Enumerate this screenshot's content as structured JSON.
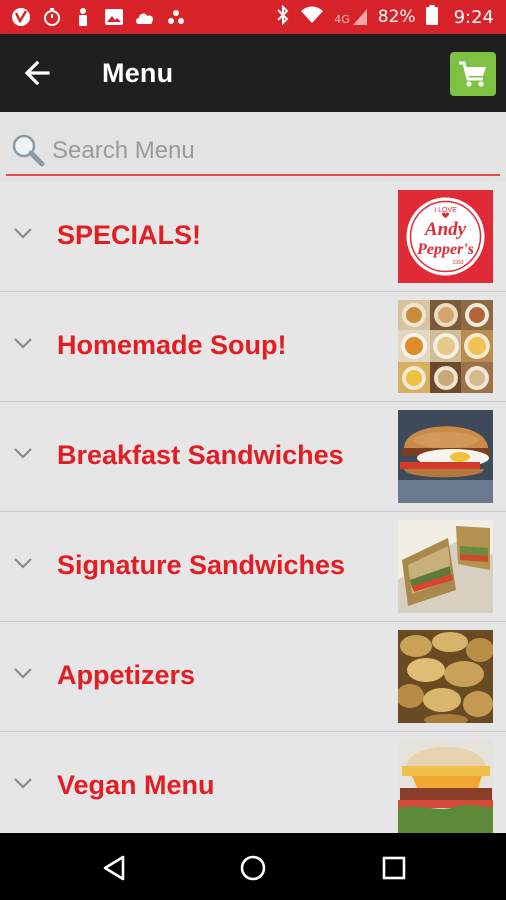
{
  "status_bar": {
    "network": "4G",
    "battery": "82%",
    "time": "9:24",
    "background": "#d8232a"
  },
  "app_bar": {
    "title": "Menu",
    "cart_color": "#7dc242"
  },
  "search": {
    "placeholder": "Search Menu"
  },
  "categories": [
    {
      "label": "SPECIALS!",
      "thumb": "logo"
    },
    {
      "label": "Homemade Soup!",
      "thumb": "soup-photo"
    },
    {
      "label": "Breakfast Sandwiches",
      "thumb": "breakfast-sandwich-photo"
    },
    {
      "label": "Signature Sandwiches",
      "thumb": "signature-sandwich-photo"
    },
    {
      "label": "Appetizers",
      "thumb": "chips-photo"
    },
    {
      "label": "Vegan Menu",
      "thumb": "vegan-burger-photo"
    }
  ],
  "logo": {
    "small_text": "I LOVE",
    "line1": "Andy",
    "line2": "Pepper's",
    "since": "1993"
  },
  "accent_color": "#e21d24"
}
